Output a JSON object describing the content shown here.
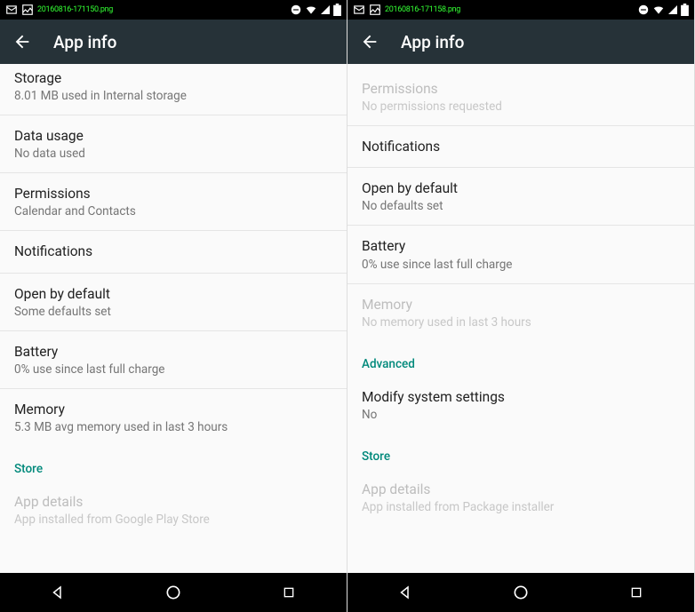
{
  "left": {
    "statusText": "20160816-171150.png",
    "title": "App info",
    "items": [
      {
        "title": "Storage",
        "sub": "8.01 MB used in Internal storage",
        "disabled": false
      },
      {
        "title": "Data usage",
        "sub": "No data used",
        "disabled": false
      },
      {
        "title": "Permissions",
        "sub": "Calendar and Contacts",
        "disabled": false
      },
      {
        "title": "Notifications",
        "sub": "",
        "disabled": false
      },
      {
        "title": "Open by default",
        "sub": "Some defaults set",
        "disabled": false
      },
      {
        "title": "Battery",
        "sub": "0% use since last full charge",
        "disabled": false
      },
      {
        "title": "Memory",
        "sub": "5.3 MB avg memory used in last 3 hours",
        "disabled": false
      }
    ],
    "sectionHeader": "Store",
    "footer": {
      "title": "App details",
      "sub": "App installed from Google Play Store",
      "disabled": true
    }
  },
  "right": {
    "statusText": "20160816-171158.png",
    "title": "App info",
    "items": [
      {
        "title": "Permissions",
        "sub": "No permissions requested",
        "disabled": true
      },
      {
        "title": "Notifications",
        "sub": "",
        "disabled": false
      },
      {
        "title": "Open by default",
        "sub": "No defaults set",
        "disabled": false
      },
      {
        "title": "Battery",
        "sub": "0% use since last full charge",
        "disabled": false
      },
      {
        "title": "Memory",
        "sub": "No memory used in last 3 hours",
        "disabled": true
      }
    ],
    "sectionHeader1": "Advanced",
    "advancedItem": {
      "title": "Modify system settings",
      "sub": "No",
      "disabled": false
    },
    "sectionHeader2": "Store",
    "footer": {
      "title": "App details",
      "sub": "App installed from Package installer",
      "disabled": true
    }
  }
}
